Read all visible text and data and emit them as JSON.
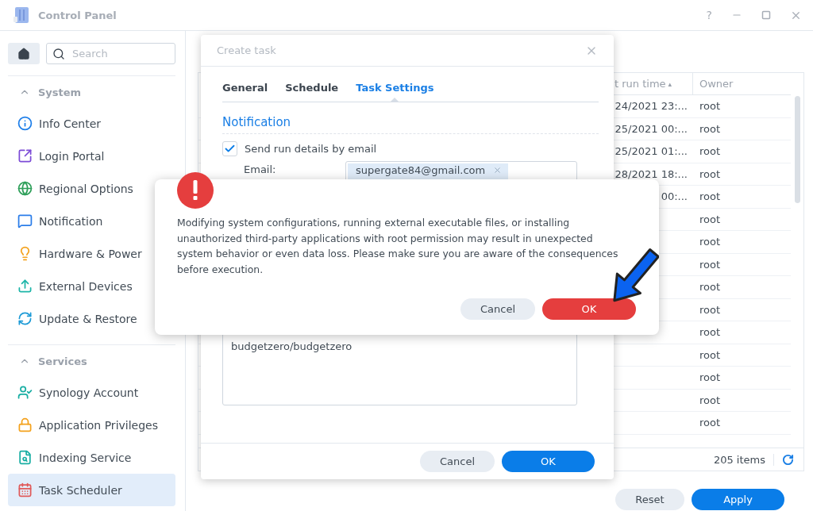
{
  "window": {
    "title": "Control Panel",
    "help": "?"
  },
  "sidebar": {
    "search": {
      "placeholder": "Search"
    },
    "sections": [
      {
        "title": "System",
        "expanded": true,
        "items": [
          {
            "label": "Info Center",
            "selected": false
          },
          {
            "label": "Login Portal",
            "selected": false
          },
          {
            "label": "Regional Options",
            "selected": false
          },
          {
            "label": "Notification",
            "selected": false
          },
          {
            "label": "Hardware & Power",
            "selected": false
          },
          {
            "label": "External Devices",
            "selected": false
          },
          {
            "label": "Update & Restore",
            "selected": false
          }
        ]
      },
      {
        "title": "Services",
        "expanded": true,
        "items": [
          {
            "label": "Synology Account",
            "selected": false
          },
          {
            "label": "Application Privileges",
            "selected": false
          },
          {
            "label": "Indexing Service",
            "selected": false
          },
          {
            "label": "Task Scheduler",
            "selected": true
          }
        ]
      }
    ]
  },
  "table": {
    "columns": [
      {
        "label": "t run time",
        "sort_mark": "▴"
      },
      {
        "label": "Owner"
      }
    ],
    "rows": [
      {
        "last_run_time": "24/2021 23:...",
        "owner": "root"
      },
      {
        "last_run_time": "25/2021 00:...",
        "owner": "root"
      },
      {
        "last_run_time": "25/2021 01:...",
        "owner": "root"
      },
      {
        "last_run_time": "28/2021 18:...",
        "owner": "root"
      },
      {
        "last_run_time": "00:...",
        "owner": "root"
      },
      {
        "owner": "root"
      },
      {
        "owner": "root"
      },
      {
        "owner": "root"
      },
      {
        "owner": "root"
      },
      {
        "owner": "root"
      },
      {
        "owner": "root"
      },
      {
        "owner": "root"
      },
      {
        "owner": "root"
      },
      {
        "owner": "root"
      },
      {
        "owner": "root"
      }
    ],
    "item_count": "205 items"
  },
  "buttons": [
    {
      "label": "Reset",
      "kind": "secondary"
    },
    {
      "label": "Apply",
      "kind": "primary"
    }
  ],
  "create_task": {
    "title": "Create task",
    "tabs": [
      {
        "label": "General",
        "selected": false
      },
      {
        "label": "Schedule",
        "selected": false
      },
      {
        "label": "Task Settings",
        "selected": true
      }
    ],
    "section_title": "Notification",
    "send_email": {
      "label": "Send run details by email",
      "checked": true
    },
    "email_label": "Email:",
    "email_tags": [
      "supergate84@gmail.com"
    ],
    "script_text": "budgetzero/budgetzero",
    "buttons": [
      {
        "label": "Cancel",
        "kind": "secondary"
      },
      {
        "label": "OK",
        "kind": "primary"
      }
    ]
  },
  "alert": {
    "message": "Modifying system configurations, running external executable files, or installing unauthorized third-party applications with root permission may result in unexpected system behavior or even data loss. Please make sure you are aware of the consequences before execution.",
    "buttons": [
      {
        "label": "Cancel",
        "kind": "secondary"
      },
      {
        "label": "OK",
        "kind": "danger"
      }
    ]
  }
}
